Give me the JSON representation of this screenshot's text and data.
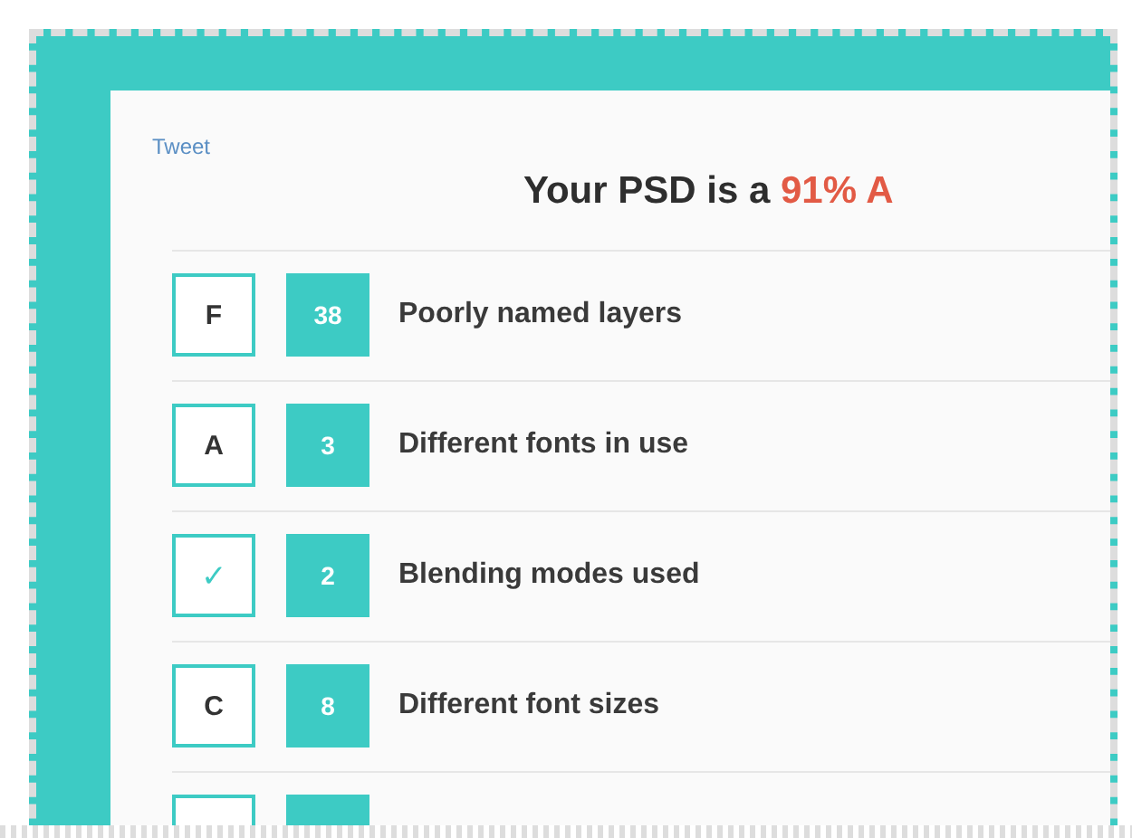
{
  "tweet_link": "Tweet",
  "title": {
    "prefix": "Your PSD is a",
    "score": "91% A"
  },
  "rows": [
    {
      "kind": "grade",
      "grade": "F",
      "count": "38",
      "label": "Poorly named layers"
    },
    {
      "kind": "grade",
      "grade": "A",
      "count": "3",
      "label": "Different fonts in use"
    },
    {
      "kind": "pass",
      "grade": "✓",
      "count": "2",
      "label": "Blending modes used"
    },
    {
      "kind": "grade",
      "grade": "C",
      "count": "8",
      "label": "Different font sizes"
    },
    {
      "kind": "grade"
    }
  ]
}
